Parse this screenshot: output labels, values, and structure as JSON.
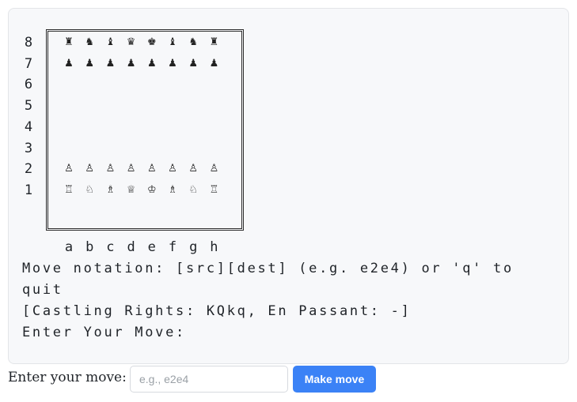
{
  "board": {
    "ranks": [
      "8",
      "7",
      "6",
      "5",
      "4",
      "3",
      "2",
      "1"
    ],
    "files": [
      "a",
      "b",
      "c",
      "d",
      "e",
      "f",
      "g",
      "h"
    ],
    "rows": [
      [
        "♜",
        "♞",
        "♝",
        "♛",
        "♚",
        "♝",
        "♞",
        "♜"
      ],
      [
        "♟",
        "♟",
        "♟",
        "♟",
        "♟",
        "♟",
        "♟",
        "♟"
      ],
      [
        "",
        "",
        "",
        "",
        "",
        "",
        "",
        ""
      ],
      [
        "",
        "",
        "",
        "",
        "",
        "",
        "",
        ""
      ],
      [
        "",
        "",
        "",
        "",
        "",
        "",
        "",
        ""
      ],
      [
        "",
        "",
        "",
        "",
        "",
        "",
        "",
        ""
      ],
      [
        "♙",
        "♙",
        "♙",
        "♙",
        "♙",
        "♙",
        "♙",
        "♙"
      ],
      [
        "♖",
        "♘",
        "♗",
        "♕",
        "♔",
        "♗",
        "♘",
        "♖"
      ]
    ]
  },
  "terminal": {
    "notation_line1": "Move notation: [src][dest] (e.g. e2e4) or 'q' to",
    "notation_line2": "quit",
    "status_line": "[Castling Rights: KQkq, En Passant: -]",
    "prompt_line": "Enter Your Move:"
  },
  "form": {
    "label": "Enter your move:",
    "placeholder": "e.g., e2e4",
    "value": "",
    "button_label": "Make move"
  }
}
